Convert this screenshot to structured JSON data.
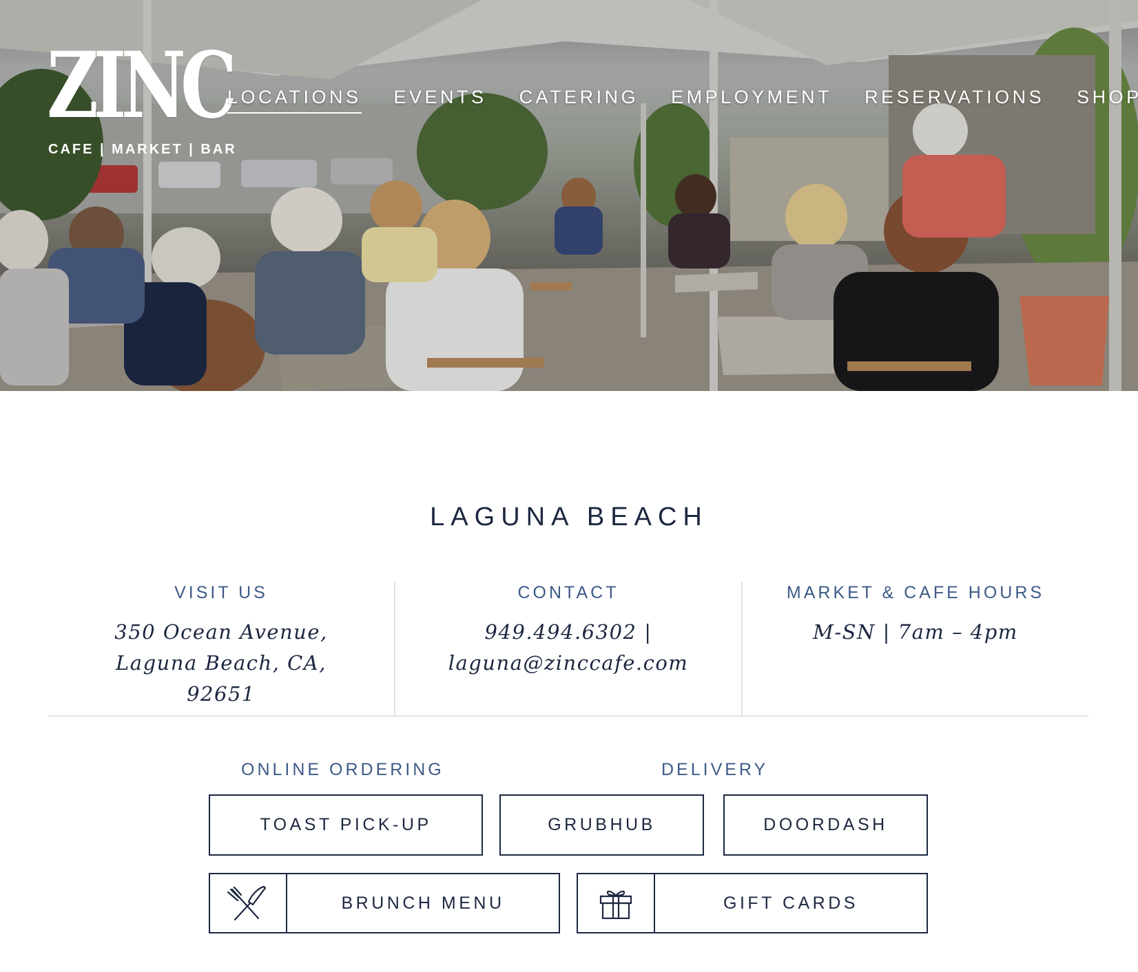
{
  "brand": {
    "logo_word": "ZINC",
    "tagline": "CAFE | MARKET | BAR"
  },
  "nav": {
    "items": [
      {
        "label": "LOCATIONS",
        "active": true
      },
      {
        "label": "EVENTS",
        "active": false
      },
      {
        "label": "CATERING",
        "active": false
      },
      {
        "label": "EMPLOYMENT",
        "active": false
      },
      {
        "label": "RESERVATIONS",
        "active": false
      },
      {
        "label": "SHOP",
        "active": false
      }
    ]
  },
  "location": {
    "title": "LAGUNA BEACH",
    "visit": {
      "heading": "VISIT US",
      "text": "350 Ocean Avenue, Laguna Beach, CA, 92651"
    },
    "contact": {
      "heading": "CONTACT",
      "text": "949.494.6302 | laguna@zinccafe.com"
    },
    "hours": {
      "heading": "MARKET & CAFE HOURS",
      "text": "M-SN | 7am – 4pm"
    }
  },
  "ordering": {
    "online_heading": "ONLINE ORDERING",
    "delivery_heading": "DELIVERY",
    "toast_label": "TOAST PICK-UP",
    "grubhub_label": "GRUBHUB",
    "doordash_label": "DOORDASH",
    "brunch_label": "BRUNCH MENU",
    "giftcards_label": "GIFT CARDS"
  },
  "icons": {
    "brunch": "fork-knife-icon",
    "giftcards": "gift-icon"
  },
  "colors": {
    "navy": "#1c2740",
    "heading_blue": "#3e5a86",
    "divider": "#e1e3e6"
  }
}
